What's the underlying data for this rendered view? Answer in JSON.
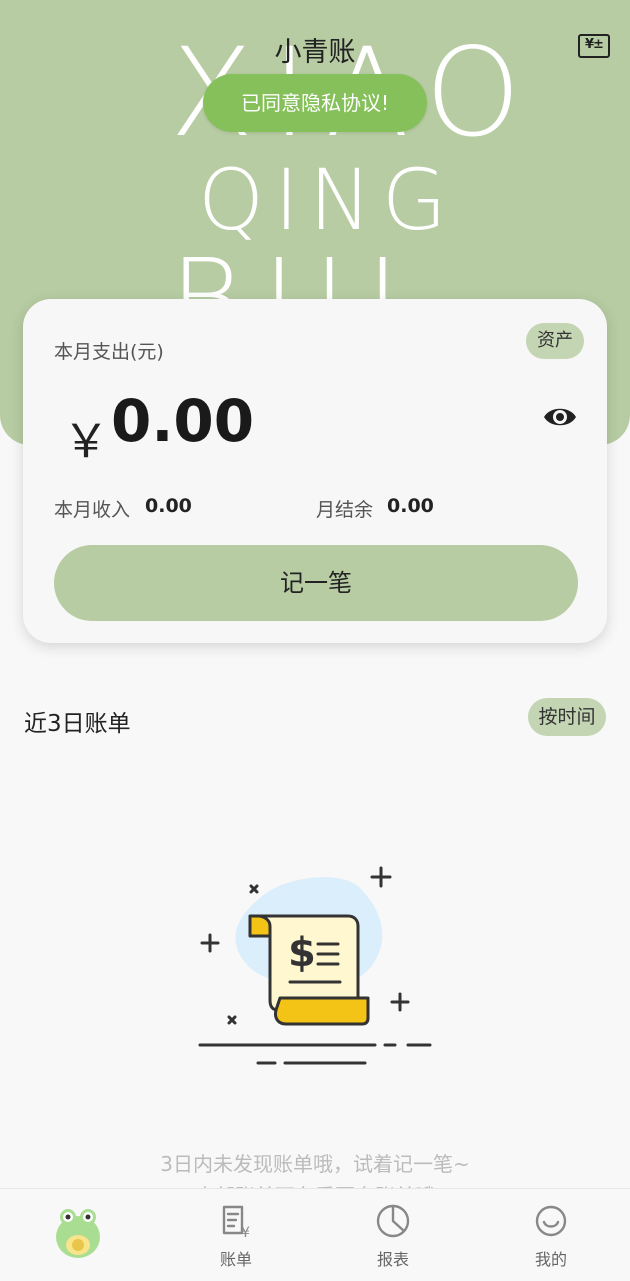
{
  "header": {
    "title": "小青账",
    "background_letters": [
      "XIAO",
      "QING",
      "BUI"
    ],
    "calculator_icon_text": "¥±",
    "toast": "已同意隐私协议!"
  },
  "summary": {
    "month_expense_label": "本月支出(元)",
    "assets_label": "资产",
    "currency_symbol": "￥",
    "expense_amount": "0.00",
    "income_label": "本月收入",
    "income_value": "0.00",
    "balance_label": "月结余",
    "balance_value": "0.00",
    "record_button": "记一笔"
  },
  "recent": {
    "title": "近3日账单",
    "sort_label": "按时间",
    "empty_message": "3日内未发现账单哦，试着记一笔~",
    "empty_message_2": "查部账单可在看更多账单哦"
  },
  "tabs": [
    {
      "label": "",
      "icon": "frog-mascot-icon"
    },
    {
      "label": "账单",
      "icon": "bill-icon"
    },
    {
      "label": "报表",
      "icon": "pie-chart-icon"
    },
    {
      "label": "我的",
      "icon": "smile-icon"
    }
  ],
  "colors": {
    "primary_green": "#b7cca3",
    "toast_green": "#85c05a",
    "badge_green": "#c4d5b3",
    "background": "#f8f8f8"
  }
}
